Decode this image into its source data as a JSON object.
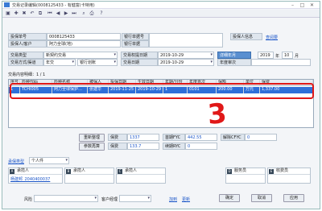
{
  "window": {
    "title": "交易记录编辑(0008125433 - 有健富(卡特用)"
  },
  "policy": {
    "holder_no_label": "投保单号",
    "holder_no_value": "0008125433",
    "holder_name_label": "投保人/客户",
    "holder_name_value": "阿力全球(地)",
    "bank_label": "银行单据号",
    "bank_label2": "银行单据",
    "holder_info_label": "投保人信息",
    "holder_info_link": "查阅要"
  },
  "trade": {
    "type_label": "交易类型",
    "type_value": "新契约交易",
    "method_label": "交易方式/渠道",
    "method_value": "年交",
    "channel_value": "银行划账",
    "submit_date_label": "交易权提日期",
    "submit_date_value": "2019-10-29",
    "effect_date_label": "交易日期",
    "effect_date_value": "2019-10-29",
    "period_btn": "详细年月",
    "year": "2019",
    "year_unit": "年",
    "month": "10",
    "month_unit": "月",
    "renew_label": "年度审次"
  },
  "grid": {
    "caption": "交易内容明细：1 / 1",
    "headers": [
      "序号",
      "险种代码",
      "险种名称",
      "被保人",
      "投保日期",
      "生效日期",
      "年期/分份",
      "年度首次",
      "保额",
      "单位",
      "保费"
    ],
    "row": [
      "1",
      "TCHI005",
      "阿力全球保护…",
      "张建华",
      "2019-11-25",
      "2019-10-29",
      "1",
      "0101",
      "200.00",
      "万元",
      "1,337.00"
    ]
  },
  "annotation": {
    "mark": "3"
  },
  "summary": {
    "total_label": "重新整理",
    "params_label": "参数再算",
    "premium_label": "保费",
    "premium_value": "1337",
    "total_premium_label": "保费",
    "total_premium_value": "133.7",
    "fyc_label": "首期FYC",
    "fyc_value": "442.55",
    "ryc_label": "续期RYC",
    "ryc_value": "0",
    "cfyc_label": "解除CFYC",
    "cfyc_value": "0"
  },
  "agent": {
    "type_label": "承保类型",
    "type_value": "个人件",
    "slots": [
      {
        "badge": "A",
        "label": "承揽人",
        "link": "杨建邦_2040400037"
      },
      {
        "badge": "B",
        "label": "承揽人",
        "link": ""
      },
      {
        "badge": "C",
        "label": "承揽人",
        "link": ""
      },
      {
        "badge": "D",
        "label": "服务员",
        "link": ""
      },
      {
        "badge": "E",
        "label": "收费员",
        "link": ""
      }
    ]
  },
  "footer": {
    "filter_label": "风险",
    "filter_value": "",
    "customer_label": "客户经理",
    "confirm_link": "加到",
    "update_link": "更新",
    "ok_label": "确定",
    "cancel_label": "取消",
    "apply_label": "应用"
  }
}
